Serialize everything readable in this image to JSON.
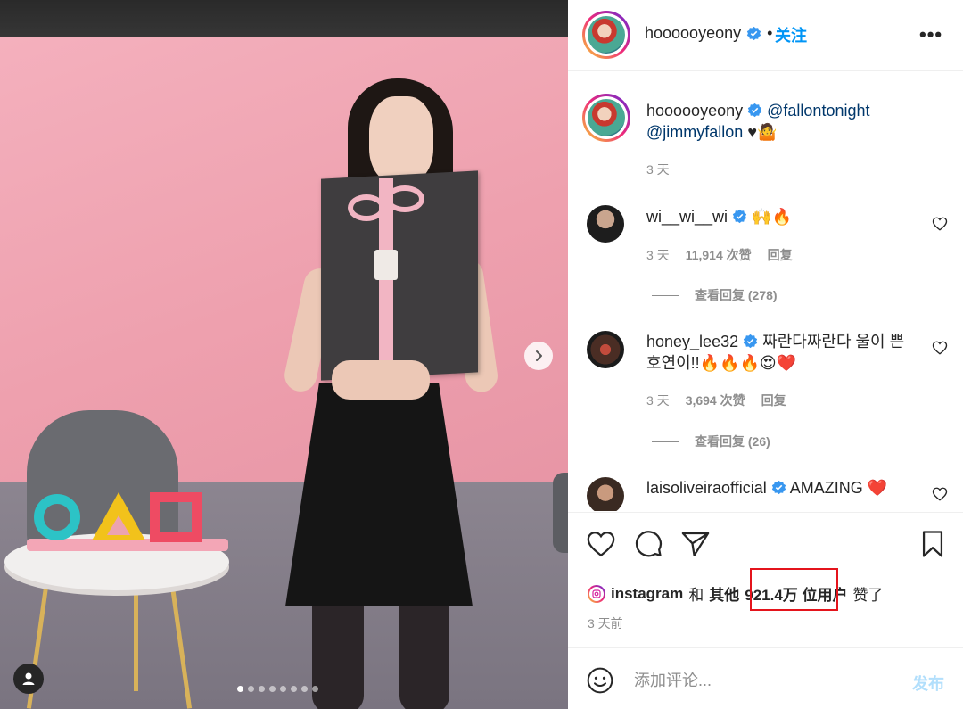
{
  "header": {
    "username": "hoooooyeony",
    "separator": "•",
    "follow_label": "关注",
    "more_label": "•••"
  },
  "caption": {
    "username": "hoooooyeony",
    "mention1": "@fallontonight",
    "mention2": "@jimmyfallon",
    "tail": "♥🤷",
    "time": "3 天"
  },
  "comments": [
    {
      "username": "wi__wi__wi",
      "text": "🙌🔥",
      "time": "3 天",
      "likes": "11,914 次赞",
      "reply_label": "回复",
      "view_replies": "查看回复 (278)"
    },
    {
      "username": "honey_lee32",
      "text": "짜란다짜란다 울이 쁜 호연이!!🔥🔥🔥😍❤️",
      "time": "3 天",
      "likes": "3,694 次赞",
      "reply_label": "回复",
      "view_replies": "查看回复 (26)"
    },
    {
      "username": "laisoliveiraofficial",
      "text": "AMAZING ❤️"
    }
  ],
  "likes_line": {
    "user": "instagram",
    "and": "和",
    "others_label": "其他",
    "count": "921.4万 位",
    "users_label": "用户",
    "suffix": "赞了"
  },
  "post_time": "3 天前",
  "add_comment": {
    "placeholder": "添加评论...",
    "post_label": "发布"
  },
  "carousel": {
    "dot_count": 8,
    "active_index": 0
  },
  "colors": {
    "accent_blue": "#0095f6",
    "post_disabled": "#b2dffc",
    "highlight_red": "#e4141c",
    "verified_blue": "#3897f0"
  }
}
